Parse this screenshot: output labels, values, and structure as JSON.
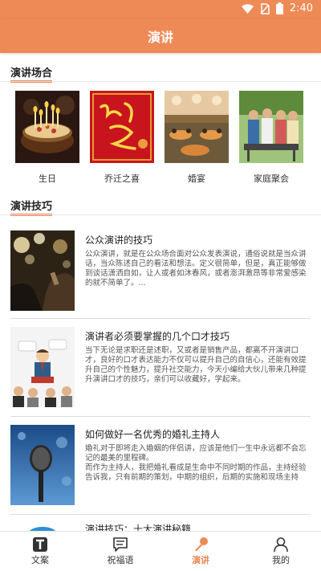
{
  "status_bar": {
    "time": "2:40",
    "icons": [
      "wifi-icon",
      "no-sim-icon",
      "battery-icon"
    ]
  },
  "header": {
    "title": "演讲"
  },
  "occasions_section": {
    "title": "演讲场合",
    "items": [
      {
        "label": "生日",
        "image": "birthday-cake-photo"
      },
      {
        "label": "乔迁之喜",
        "image": "housewarming-card"
      },
      {
        "label": "婚宴",
        "image": "wedding-banquet-photo"
      },
      {
        "label": "家庭聚会",
        "image": "family-gathering-photo"
      }
    ]
  },
  "skills_section": {
    "title": "演讲技巧",
    "articles": [
      {
        "title": "公众演讲的技巧",
        "desc": "公众演讲，就是在公众场合面对公众发表演说，通俗说就是当众讲话，当众陈述自己的看法和想法。定义很简单，但是，真正能够做到谈话潇洒自如，让人或者如沐春风，或者澎湃激昂等非常爱感染的就不简单了。...",
        "image": "stage-speaker-photo"
      },
      {
        "title": "演讲者必须要掌握的几个口才技巧",
        "desc": "当下无论是求职还是述职，又或者是销售产品，都离不开演讲口才，良好的口才表达能力不仅可以提升自己的自信心，还能有效提升自己的个性魅力，提升社交能力，今天小编给大伙儿带来几种提升演讲口才的技巧，亲们可以收藏好，学起来。",
        "image": "speaker-illustration"
      },
      {
        "title": "如何做好一名优秀的婚礼主持人",
        "desc": "婚礼对于即将走入婚姻的伴侣讲，应该是他们一生中永远都不会忘记的最美的里程碑。\n而作为主持人，我把婚礼看成是生命中不同时期的作品，主持经验告诉我，只有前期的策划，中期的组织，后期的实施和现场主持",
        "image": "microphone-photo"
      },
      {
        "title": "演讲技巧：十大演讲秘籍",
        "desc": "",
        "image": "blue-icon"
      }
    ]
  },
  "tab_bar": {
    "tabs": [
      {
        "label": "文案",
        "icon": "text-t-icon"
      },
      {
        "label": "祝福语",
        "icon": "chat-bubble-icon"
      },
      {
        "label": "演讲",
        "icon": "microphone-icon",
        "active": true
      },
      {
        "label": "我的",
        "icon": "person-icon"
      }
    ]
  },
  "colors": {
    "accent": "#ee8a55"
  }
}
